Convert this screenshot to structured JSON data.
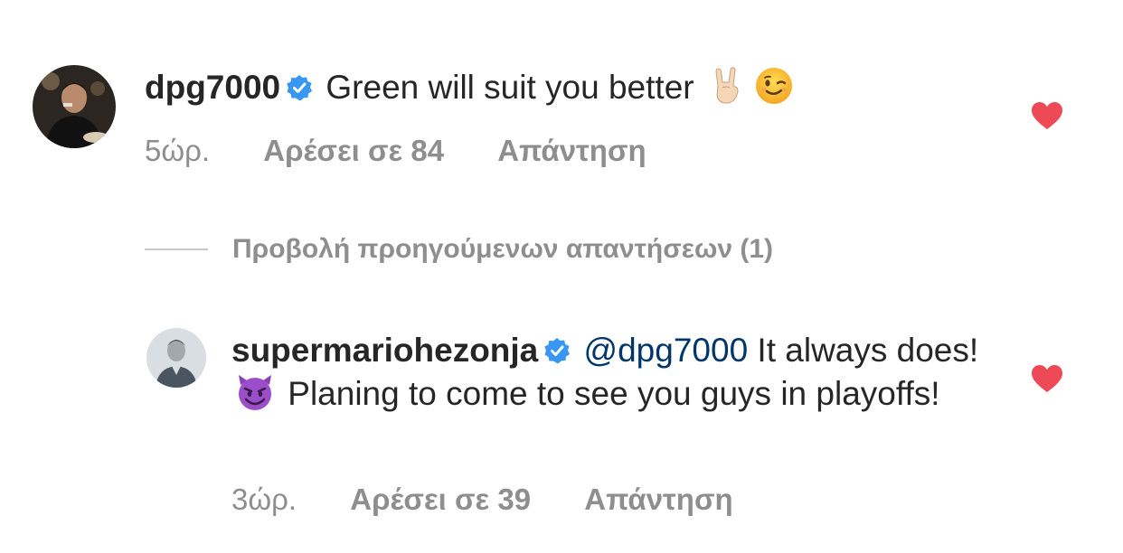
{
  "colors": {
    "text": "#262626",
    "secondary": "#8e8e8e",
    "mention": "#00376b",
    "verified": "#3897f0",
    "heart": "#ed4956"
  },
  "comments": [
    {
      "username": "dpg7000",
      "verified": true,
      "text": "Green will suit you better",
      "emojis": [
        "rock-on-hand-emoji",
        "winking-face-emoji"
      ],
      "time": "5ώρ.",
      "likes": "Αρέσει σε 84",
      "reply": "Απάντηση",
      "liked": true
    },
    {
      "username": "supermariohezonja",
      "verified": true,
      "mention": "@dpg7000",
      "text_part1": " It always does!",
      "emoji": "smiling-devil-emoji",
      "text_part2": " Planing to come to see you guys in playoffs!",
      "time": "3ώρ.",
      "likes": "Αρέσει σε 39",
      "reply": "Απάντηση",
      "liked": true
    }
  ],
  "view_replies": {
    "label": "Προβολή προηγούμενων απαντήσεων (1)"
  }
}
